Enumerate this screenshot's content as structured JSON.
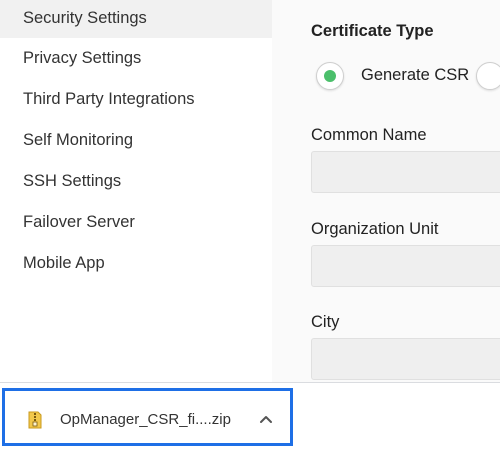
{
  "sidebar": {
    "items": [
      {
        "label": "Security Settings",
        "active": true
      },
      {
        "label": "Privacy Settings"
      },
      {
        "label": "Third Party Integrations"
      },
      {
        "label": "Self Monitoring"
      },
      {
        "label": "SSH Settings"
      },
      {
        "label": "Failover Server"
      },
      {
        "label": "Mobile App"
      }
    ]
  },
  "main": {
    "certificate_type_title": "Certificate Type",
    "radio_generate_csr_label": "Generate CSR",
    "common_name_label": "Common Name",
    "organization_unit_label": "Organization Unit",
    "city_label": "City"
  },
  "download": {
    "file_name": "OpManager_CSR_fi....zip",
    "icon": "zip-file-icon"
  },
  "colors": {
    "radio_selected": "#4bbf6b",
    "download_focus_border": "#1e6fe6",
    "input_bg": "#efefef"
  }
}
